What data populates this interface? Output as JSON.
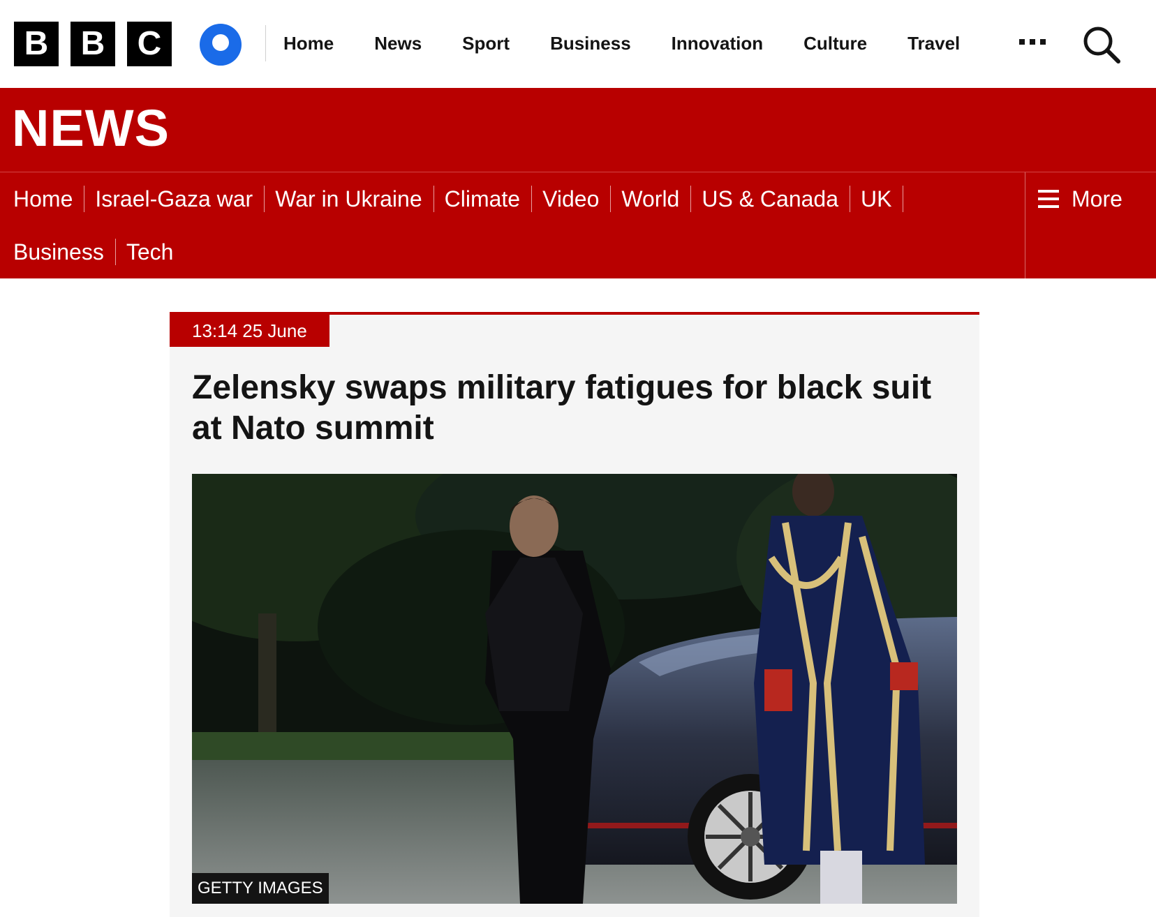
{
  "brand": {
    "logo_letters": [
      "B",
      "B",
      "C"
    ]
  },
  "top_nav": {
    "items": [
      "Home",
      "News",
      "Sport",
      "Business",
      "Innovation",
      "Culture",
      "Travel"
    ]
  },
  "section": {
    "title": "NEWS",
    "nav_items": [
      "Home",
      "Israel-Gaza war",
      "War in Ukraine",
      "Climate",
      "Video",
      "World",
      "US & Canada",
      "UK",
      "Business",
      "Tech"
    ],
    "more_label": "More"
  },
  "article": {
    "timestamp": "13:14 25 June",
    "headline": "Zelensky swaps military fatigues for black suit at Nato summit",
    "image_credit": "GETTY IMAGES"
  },
  "colors": {
    "brand_red": "#b80000",
    "text_dark": "#141414",
    "card_bg": "#f5f5f5"
  },
  "icons": {
    "account": "account-icon",
    "more_menu": "ellipsis-icon",
    "search": "search-icon",
    "hamburger": "menu-icon"
  }
}
